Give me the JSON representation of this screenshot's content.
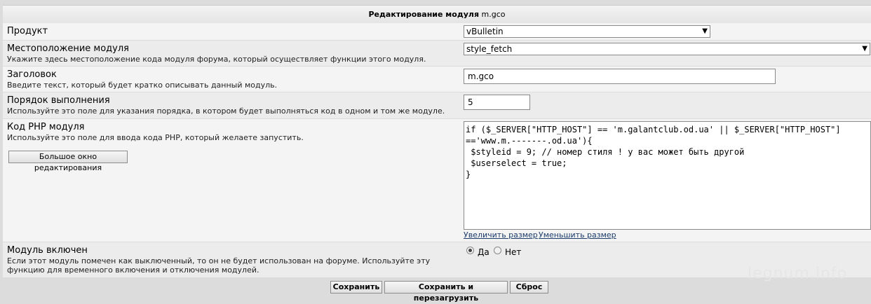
{
  "header": {
    "title_bold": "Редактирование модуля",
    "title_rest": "m.gco"
  },
  "product": {
    "label": "Продукт",
    "value": "vBulletin"
  },
  "location": {
    "label": "Местоположение модуля",
    "desc": "Укажите здесь местоположение кода модуля форума, который осуществляет функции этого модуля.",
    "value": "style_fetch"
  },
  "title_field": {
    "label": "Заголовок",
    "desc": "Введите текст, который будет кратко описывать данный модуль.",
    "value": "m.gco"
  },
  "order": {
    "label": "Порядок выполнения",
    "desc": "Используйте это поле для указания порядка, в котором будет выполняться код в одном и том же модуле.",
    "value": "5"
  },
  "php": {
    "label": "Код PHP модуля",
    "desc": "Используйте это поле для ввода кода PHP, который желаете запустить.",
    "big_editor_button": "Большое окно редактирования",
    "code": "if ($_SERVER[\"HTTP_HOST\"] == 'm.galantclub.od.ua' || $_SERVER[\"HTTP_HOST\"]\n=='www.m.-------.od.ua'){\n $styleid = 9; // номер стиля ! у вас может быть другой\n $userselect = true;\n}",
    "increase_link": "Увеличить размер",
    "decrease_link": "Уменьшить размер"
  },
  "enabled": {
    "label": "Модуль включен",
    "desc_line1": "Если этот модуль помечен как выключенный, то он не будет использован на форуме. Используйте эту",
    "desc_line2": "функцию для временного включения и отключения модулей.",
    "yes": "Да",
    "no": "Нет",
    "selected": "yes"
  },
  "footer": {
    "save": "Сохранить",
    "save_reload": "Сохранить и перезагрузить",
    "reset": "Сброс"
  },
  "watermark": "legnum.info"
}
